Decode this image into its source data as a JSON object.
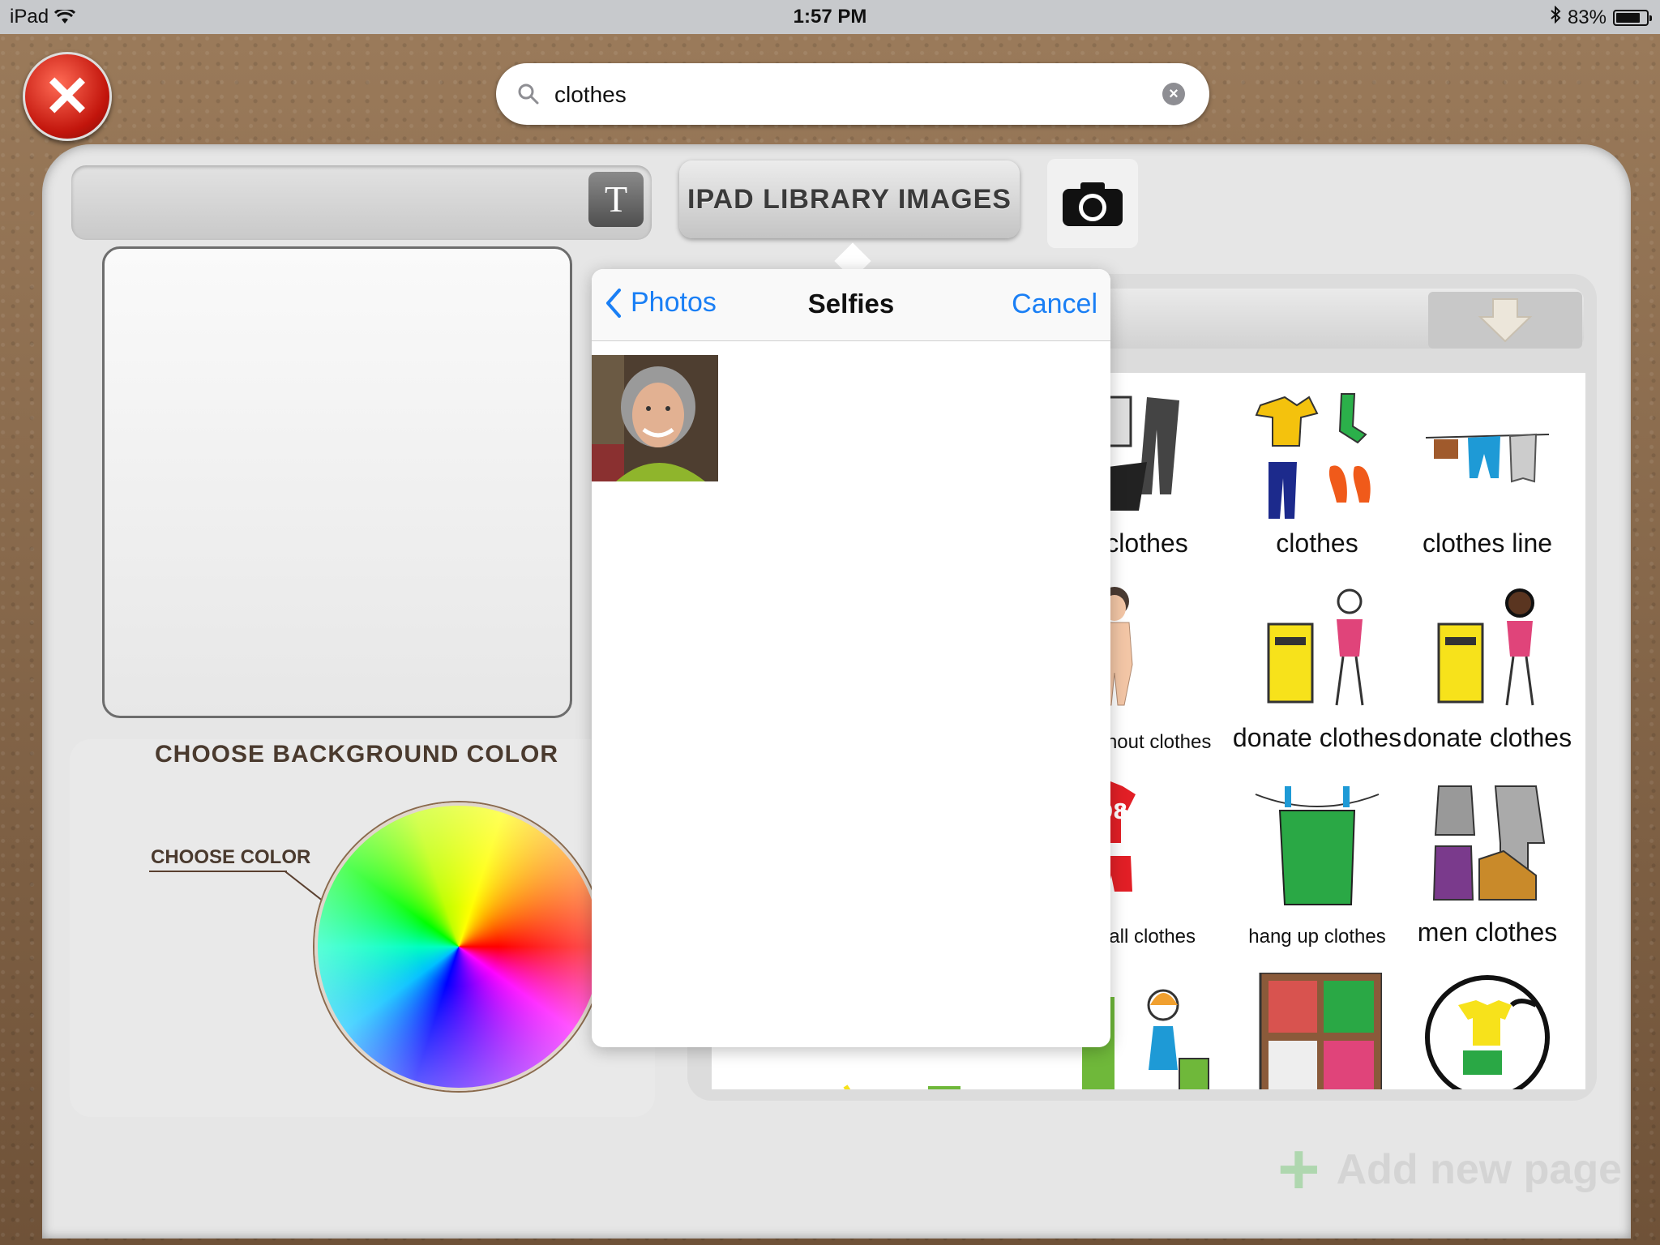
{
  "status": {
    "device": "iPad",
    "time": "1:57 PM",
    "battery": "83%",
    "battery_level": 0.83
  },
  "search": {
    "value": "clothes",
    "placeholder": ""
  },
  "toolbar": {
    "library_label": "IPAD LIBRARY IMAGES",
    "text_tool_label": "T"
  },
  "color_panel": {
    "title": "CHOOSE BACKGROUND COLOR",
    "choose_color": "CHOOSE COLOR"
  },
  "popover": {
    "back_label": "Photos",
    "title": "Selfies",
    "cancel_label": "Cancel"
  },
  "grid": {
    "items": [
      {
        "label": "clothes"
      },
      {
        "label": "clothes"
      },
      {
        "label": "clothes line"
      },
      {
        "label": "without clothes"
      },
      {
        "label": "donate clothes"
      },
      {
        "label": "donate clothes"
      },
      {
        "label": "ball clothes"
      },
      {
        "label": "hang up clothes"
      },
      {
        "label": "men clothes"
      }
    ]
  },
  "add_page": {
    "label": "Add new page"
  },
  "colors": {
    "ios_blue": "#1a7ff5",
    "close_red": "#c2150c",
    "leather": "#8a6a4d"
  }
}
